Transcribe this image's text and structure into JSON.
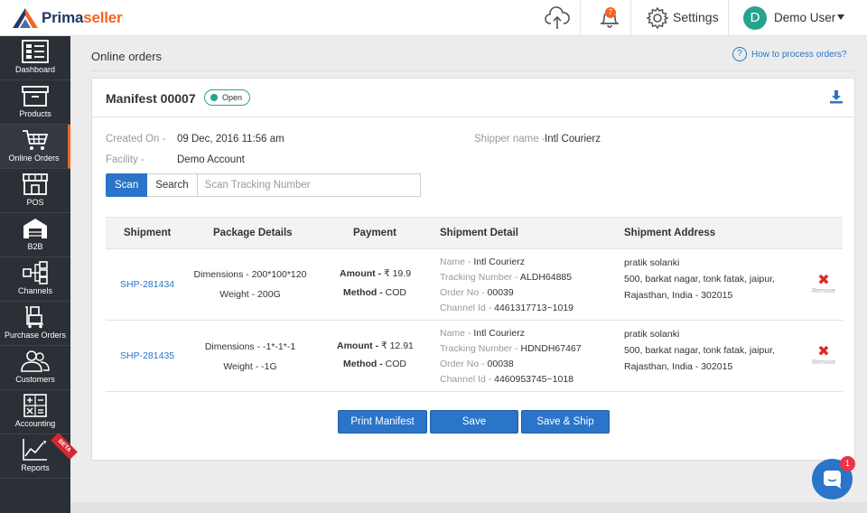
{
  "app": {
    "logo_text_prefix": "Prima",
    "logo_text_suffix": "seller",
    "colors": {
      "brand_blue": "#1f3a64",
      "brand_orange": "#f26522",
      "primary": "#2a74c9",
      "open_green": "#27a38d",
      "remove_red": "#e0282a"
    }
  },
  "topbar": {
    "notifications_count": "7",
    "settings_label": "Settings",
    "user_initial": "D",
    "user_name": "Demo User"
  },
  "sidebar": {
    "items": [
      {
        "label": "Dashboard",
        "icon": "dashboard-icon"
      },
      {
        "label": "Products",
        "icon": "products-icon"
      },
      {
        "label": "Online Orders",
        "icon": "cart-icon",
        "active": true
      },
      {
        "label": "POS",
        "icon": "store-icon"
      },
      {
        "label": "B2B",
        "icon": "warehouse-icon"
      },
      {
        "label": "Channels",
        "icon": "channels-icon"
      },
      {
        "label": "Purchase Orders",
        "icon": "trolley-icon"
      },
      {
        "label": "Customers",
        "icon": "customers-icon"
      },
      {
        "label": "Accounting",
        "icon": "calculator-icon"
      },
      {
        "label": "Reports",
        "icon": "chart-icon",
        "badge": "BETA"
      }
    ]
  },
  "page": {
    "title": "Online orders",
    "help_link": "How to process orders?"
  },
  "manifest": {
    "title": "Manifest 00007",
    "status": "Open",
    "created_on_label": "Created On -",
    "created_on": "09 Dec, 2016 11:56 am",
    "facility_label": "Facility -",
    "facility": "Demo Account",
    "shipper_label": "Shipper name -",
    "shipper": "Intl Courierz"
  },
  "scan": {
    "scan_label": "Scan",
    "search_label": "Search",
    "placeholder": "Scan Tracking Number"
  },
  "table": {
    "headers": [
      "Shipment",
      "Package Details",
      "Payment",
      "Shipment Detail",
      "Shipment Address"
    ],
    "name_label": "Name -",
    "tracking_label": "Tracking Number -",
    "order_label": "Order No -",
    "channel_label": "Channel Id -",
    "amount_label": "Amount -",
    "method_label": "Method -",
    "remove_label": "Remove",
    "rows": [
      {
        "shipment_id": "SHP-281434",
        "dimensions": "Dimensions - 200*100*120",
        "weight": "Weight - 200G",
        "amount": "₹ 19.9",
        "method": "COD",
        "name": "Intl Courierz",
        "tracking": "ALDH64885",
        "order_no": "00039",
        "channel_id": "4461317713~1019",
        "addr_name": "pratik solanki",
        "addr_line1": "500, barkat nagar, tonk fatak, jaipur,",
        "addr_line2": "Rajasthan, India - 302015"
      },
      {
        "shipment_id": "SHP-281435",
        "dimensions": "Dimensions - -1*-1*-1",
        "weight": "Weight - -1G",
        "amount": "₹ 12.91",
        "method": "COD",
        "name": "Intl Courierz",
        "tracking": "HDNDH67467",
        "order_no": "00038",
        "channel_id": "4460953745~1018",
        "addr_name": "pratik solanki",
        "addr_line1": "500, barkat nagar, tonk fatak, jaipur,",
        "addr_line2": "Rajasthan, India - 302015"
      }
    ]
  },
  "actions": {
    "print_manifest": "Print Manifest",
    "save": "Save",
    "save_ship": "Save & Ship"
  },
  "chat": {
    "unread": "1"
  }
}
